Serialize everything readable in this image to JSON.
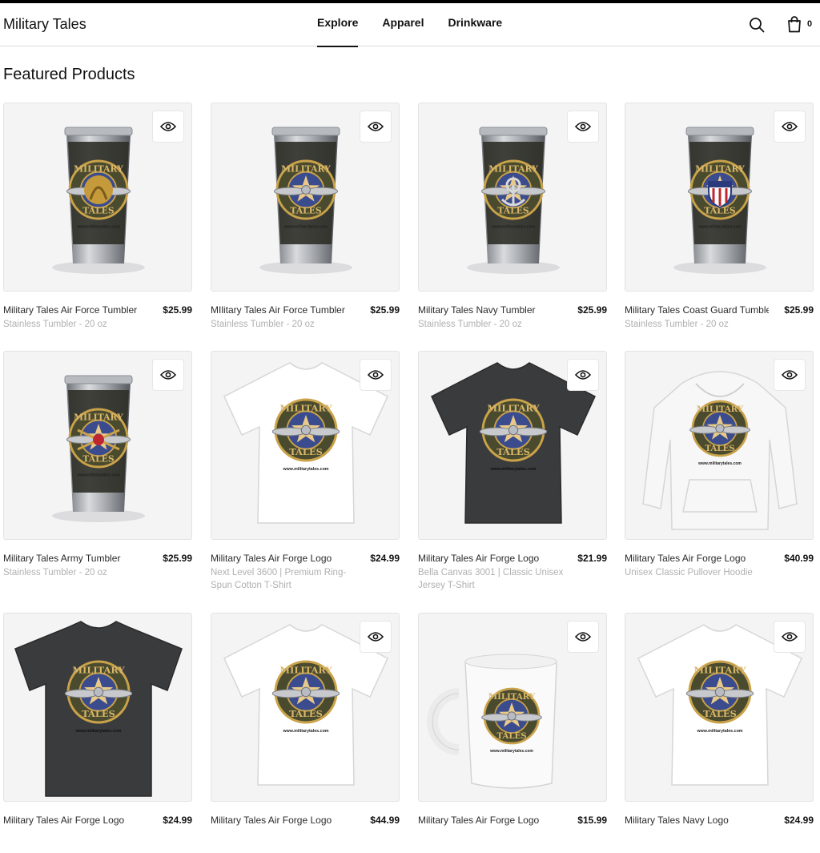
{
  "header": {
    "brand": "Military Tales",
    "nav": [
      {
        "label": "Explore",
        "active": true
      },
      {
        "label": "Apparel",
        "active": false
      },
      {
        "label": "Drinkware",
        "active": false
      }
    ],
    "search_icon": "search-icon",
    "cart_icon": "shopping-bag-icon",
    "cart_count": "0"
  },
  "main": {
    "title": "Featured Products",
    "quick_view_icon": "eye-icon",
    "products": [
      {
        "name": "Military Tales Air Force Tumbler",
        "price": "$25.99",
        "desc": "Stainless Tumbler - 20 oz",
        "kind": "tumbler",
        "emblem": "marine"
      },
      {
        "name": "MIlitary Tales Air Force Tumbler",
        "price": "$25.99",
        "desc": "Stainless Tumbler - 20 oz",
        "kind": "tumbler",
        "emblem": "wings"
      },
      {
        "name": "Military Tales Navy Tumbler",
        "price": "$25.99",
        "desc": "Stainless Tumbler - 20 oz",
        "kind": "tumbler",
        "emblem": "anchor"
      },
      {
        "name": "Military Tales Coast Guard Tumbler",
        "price": "$25.99",
        "desc": "Stainless Tumbler - 20 oz",
        "kind": "tumbler",
        "emblem": "shield"
      },
      {
        "name": "Military Tales Army Tumbler",
        "price": "$25.99",
        "desc": "Stainless Tumbler - 20 oz",
        "kind": "tumbler",
        "emblem": "army"
      },
      {
        "name": "Military Tales Air Forge Logo",
        "price": "$24.99",
        "desc": "Next Level 3600 | Premium Ring-Spun Cotton T-Shirt",
        "kind": "tshirt-white"
      },
      {
        "name": "Military Tales Air Forge Logo",
        "price": "$21.99",
        "desc": "Bella Canvas 3001 | Classic Unisex Jersey T-Shirt",
        "kind": "tshirt-dark"
      },
      {
        "name": "Military Tales Air Forge Logo",
        "price": "$40.99",
        "desc": "Unisex Classic Pullover Hoodie",
        "kind": "hoodie"
      },
      {
        "name": "Military Tales Air Forge Logo",
        "price": "$24.99",
        "desc": "",
        "kind": "tshirt-dark-flat"
      },
      {
        "name": "Military Tales Air Forge Logo",
        "price": "$44.99",
        "desc": "",
        "kind": "tshirt-white"
      },
      {
        "name": "Military Tales Air Forge Logo",
        "price": "$15.99",
        "desc": "",
        "kind": "mug"
      },
      {
        "name": "Military Tales Navy Logo",
        "price": "$24.99",
        "desc": "",
        "kind": "tshirt-white"
      }
    ],
    "logo_text": {
      "top": "MILITARY",
      "bottom": "TALES",
      "url": "www.militarytales.com"
    }
  }
}
